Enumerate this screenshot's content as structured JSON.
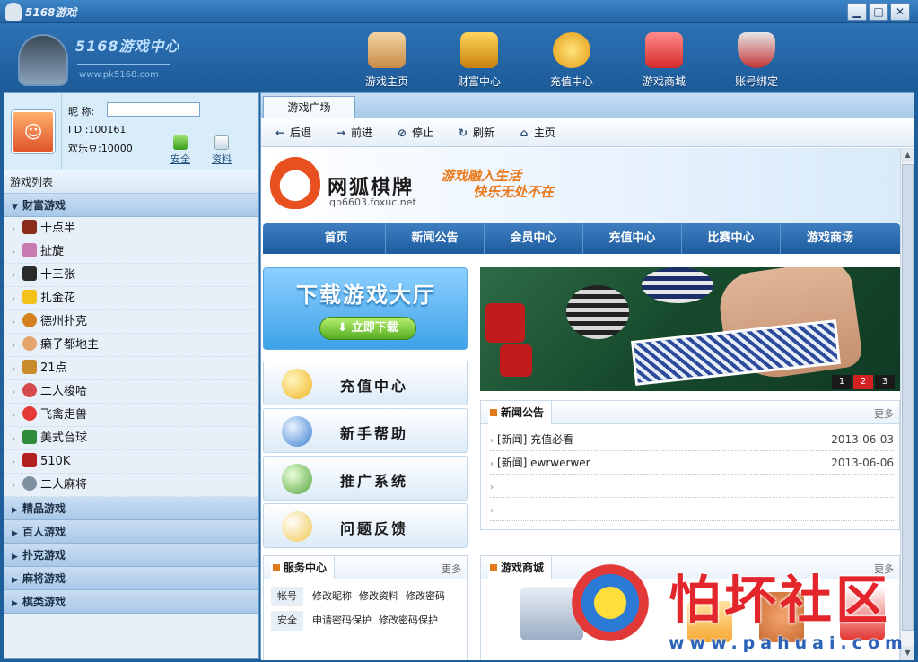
{
  "window": {
    "title": "5168游戏",
    "min": "▁",
    "max": "□",
    "close": "✕"
  },
  "header": {
    "logo_title": "5168游戏中心",
    "logo_url": "www.pk5168.com",
    "nav": [
      {
        "label": "游戏主页",
        "icon": "house-icon",
        "color": "#d9a25a"
      },
      {
        "label": "财富中心",
        "icon": "treasure-chest-icon",
        "color": "#e6a21f"
      },
      {
        "label": "充值中心",
        "icon": "gold-coin-icon",
        "color": "#f2b51d"
      },
      {
        "label": "游戏商城",
        "icon": "gift-box-icon",
        "color": "#e84343"
      },
      {
        "label": "账号绑定",
        "icon": "shield-icon",
        "color": "#c93a3a"
      }
    ]
  },
  "profile": {
    "nick_label": "昵  称:",
    "id_label": "I  D :",
    "id_value": "100161",
    "beans_label": "欢乐豆:",
    "beans_value": "10000",
    "safe": "安全",
    "info": "资料"
  },
  "gamelist": {
    "title": "游戏列表",
    "open_category": "财富游戏",
    "games": [
      {
        "label": "十点半",
        "color": "#8a2b1b"
      },
      {
        "label": "扯旋",
        "color": "#c77ab0"
      },
      {
        "label": "十三张",
        "color": "#2a2a2a"
      },
      {
        "label": "扎金花",
        "color": "#f2c21b"
      },
      {
        "label": "德州扑克",
        "color": "#d5811d"
      },
      {
        "label": "癞子都地主",
        "color": "#e6a56b"
      },
      {
        "label": "21点",
        "color": "#c98c2c"
      },
      {
        "label": "二人梭哈",
        "color": "#d54a4a"
      },
      {
        "label": "飞禽走兽",
        "color": "#e53838"
      },
      {
        "label": "美式台球",
        "color": "#2f8a3a"
      },
      {
        "label": "510K",
        "color": "#b22020"
      },
      {
        "label": "二人麻将",
        "color": "#7f8f9f"
      }
    ],
    "categories": [
      "精品游戏",
      "百人游戏",
      "扑克游戏",
      "麻将游戏",
      "棋类游戏"
    ]
  },
  "tab": {
    "label": "游戏广场"
  },
  "toolbar": {
    "back": "后退",
    "forward": "前进",
    "stop": "停止",
    "refresh": "刷新",
    "home": "主页"
  },
  "site": {
    "brand": "网狐棋牌",
    "brand_url": "qp6603.foxuc.net",
    "slogan1": "游戏融入生活",
    "slogan2": "快乐无处不在",
    "nav": [
      "首页",
      "新闻公告",
      "会员中心",
      "充值中心",
      "比赛中心",
      "游戏商场"
    ],
    "download_title": "下载游戏大厅",
    "download_button": "立即下载",
    "menu": [
      "充值中心",
      "新手帮助",
      "推广系统",
      "问题反馈"
    ],
    "slides": [
      "1",
      "2",
      "3"
    ],
    "active_slide": 2,
    "news": {
      "title": "新闻公告",
      "more": "更多",
      "items": [
        {
          "text": "[新闻] 充值必看",
          "date": "2013-06-03"
        },
        {
          "text": "[新闻] ewrwerwer",
          "date": "2013-06-06"
        }
      ]
    },
    "service": {
      "title": "服务中心",
      "more": "更多",
      "rows": [
        {
          "label": "帐号",
          "links": [
            "修改昵称",
            "修改资料",
            "修改密码"
          ]
        },
        {
          "label": "安全",
          "links": [
            "申请密码保护",
            "修改密码保护"
          ]
        }
      ]
    },
    "shop": {
      "title": "游戏商城",
      "more": "更多"
    }
  },
  "watermark": {
    "text": "怕坏社区",
    "url": "www.pahuai.com"
  }
}
